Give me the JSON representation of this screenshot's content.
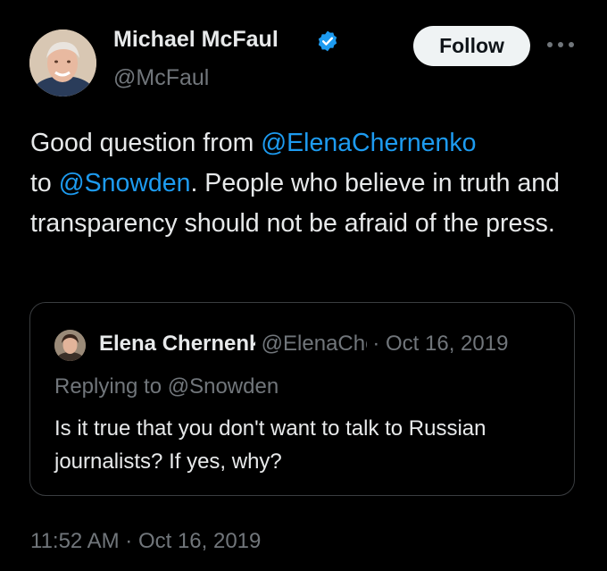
{
  "author": {
    "name": "Michael McFaul",
    "handle": "@McFaul",
    "verified": true,
    "avatar": "profile-photo"
  },
  "actions": {
    "follow_label": "Follow",
    "more_icon": "more-horizontal-icon"
  },
  "tweet": {
    "text_before_1": "Good question from ",
    "mention_1": "@ElenaChernenko",
    "text_before_2": "to ",
    "mention_2": "@Snowden",
    "text_after": ".  People who believe in truth and transparency should not be afraid of the press.",
    "timestamp": "11:52 AM · Oct 16, 2019"
  },
  "quoted_tweet": {
    "name": "Elena Chernenko",
    "handle": "@ElenaChernenko",
    "separator": "·",
    "date": "Oct 16, 2019",
    "replying_to": "Replying to @Snowden",
    "text": "Is it true that you don't want to talk to Russian journalists? If yes, why?"
  },
  "colors": {
    "background": "#000000",
    "text": "#e7e9ea",
    "muted": "#71767b",
    "accent": "#1d9bf0",
    "follow_bg": "#eff3f4"
  }
}
